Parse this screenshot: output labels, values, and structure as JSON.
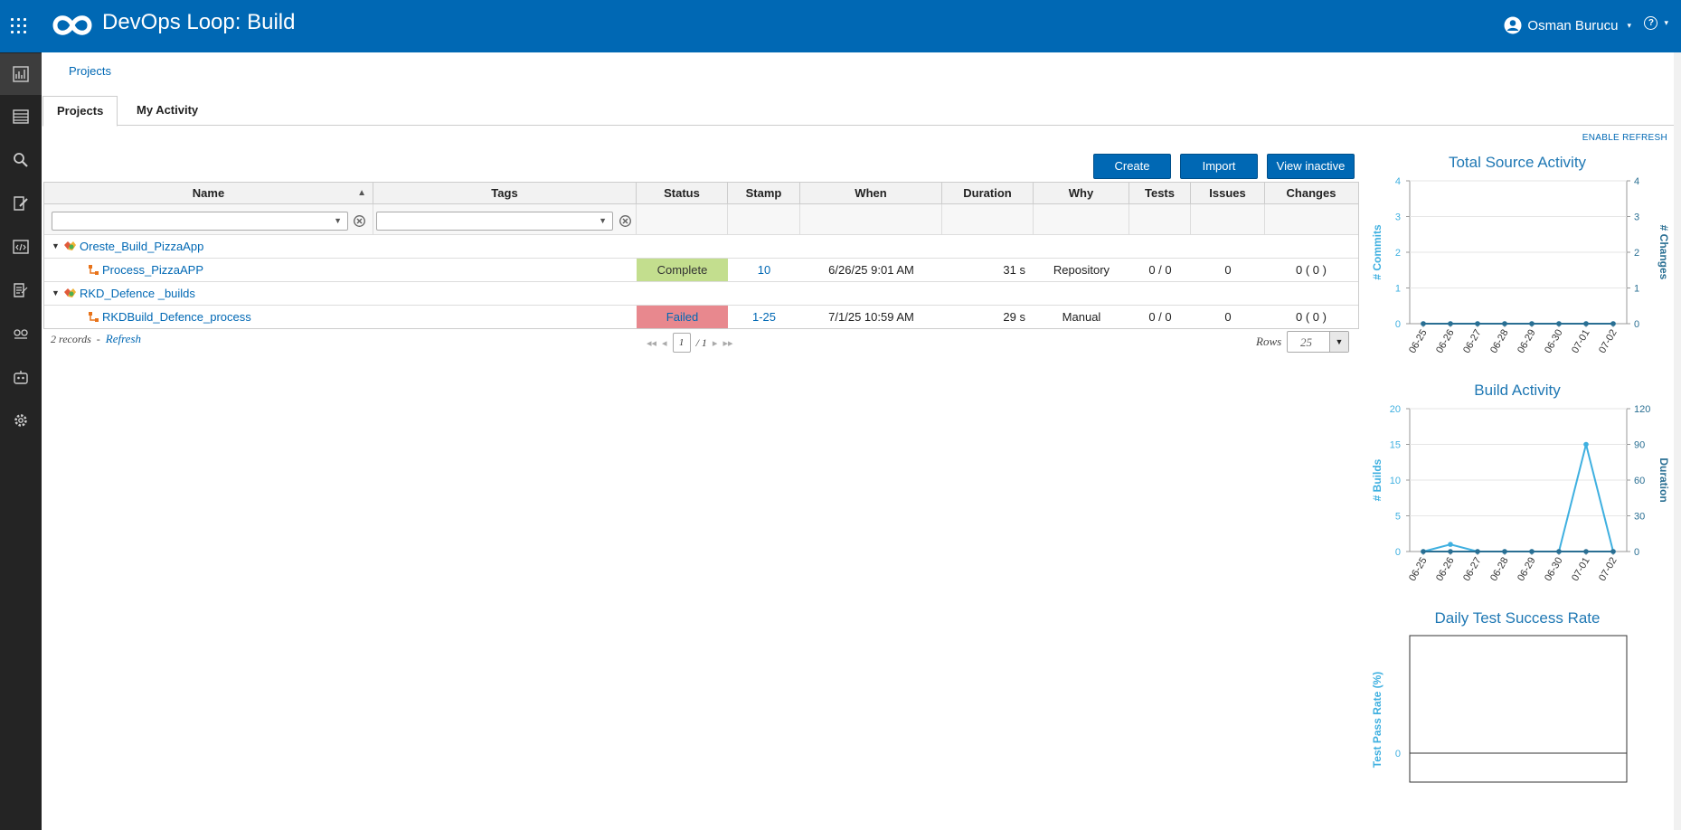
{
  "app": {
    "title": "DevOps Loop: Build"
  },
  "user": {
    "name": "Osman Burucu"
  },
  "breadcrumb": {
    "projects": "Projects"
  },
  "tabs": [
    {
      "label": "Projects",
      "active": true
    },
    {
      "label": "My Activity",
      "active": false
    }
  ],
  "toolbar": {
    "enable_refresh": "ENABLE REFRESH",
    "create": "Create",
    "import": "Import",
    "view_inactive": "View inactive"
  },
  "grid": {
    "columns": [
      "Name",
      "Tags",
      "Status",
      "Stamp",
      "When",
      "Duration",
      "Why",
      "Tests",
      "Issues",
      "Changes"
    ],
    "groups": [
      {
        "name": "Oreste_Build_PizzaApp",
        "process": {
          "name": "Process_PizzaAPP",
          "status": "Complete",
          "stamp": "10",
          "when": "6/26/25 9:01 AM",
          "duration": "31 s",
          "why": "Repository",
          "tests": "0 / 0",
          "issues": "0",
          "changes": "0 ( 0 )"
        }
      },
      {
        "name": "RKD_Defence _builds",
        "process": {
          "name": "RKDBuild_Defence_process",
          "status": "Failed",
          "stamp": "1-25",
          "when": "7/1/25 10:59 AM",
          "duration": "29 s",
          "why": "Manual",
          "tests": "0 / 0",
          "issues": "0",
          "changes": "0 ( 0 )"
        }
      }
    ]
  },
  "footer": {
    "records": "2 records",
    "sep": "-",
    "refresh": "Refresh",
    "page": "1",
    "of": "/ 1",
    "rows_label": "Rows",
    "rows_value": "25"
  },
  "colors": {
    "brand": "#0068b4",
    "complete": "#c3de8e",
    "failed": "#e8888e",
    "chart_light": "#3fb0e0",
    "chart_dark": "#2a6f93"
  },
  "chart_data": [
    {
      "type": "line",
      "title": "Total Source Activity",
      "categories": [
        "06-25",
        "06-26",
        "06-27",
        "06-28",
        "06-29",
        "06-30",
        "07-01",
        "07-02"
      ],
      "ylabel": "# Commits",
      "y2label": "# Changes",
      "ylim": [
        0,
        4
      ],
      "y2lim": [
        0,
        4
      ],
      "yticks": [
        0,
        1,
        2,
        3,
        4
      ],
      "y2ticks": [
        0,
        1,
        2,
        3,
        4
      ],
      "series": [
        {
          "values": [
            0,
            0,
            0,
            0,
            0,
            0,
            0,
            0
          ],
          "axis": "left",
          "color": "#3fb0e0"
        },
        {
          "values": [
            0,
            0,
            0,
            0,
            0,
            0,
            0,
            0
          ],
          "axis": "right",
          "color": "#2a6f93"
        }
      ]
    },
    {
      "type": "line",
      "title": "Build Activity",
      "categories": [
        "06-25",
        "06-26",
        "06-27",
        "06-28",
        "06-29",
        "06-30",
        "07-01",
        "07-02"
      ],
      "ylabel": "# Builds",
      "y2label": "Duration",
      "ylim": [
        0,
        20
      ],
      "y2lim": [
        0,
        120
      ],
      "yticks": [
        0,
        5,
        10,
        15,
        20
      ],
      "y2ticks": [
        0,
        30,
        60,
        90,
        120
      ],
      "series": [
        {
          "values": [
            0,
            1,
            0,
            0,
            0,
            0,
            15,
            0
          ],
          "axis": "left",
          "color": "#3fb0e0"
        },
        {
          "values": [
            0,
            0,
            0,
            0,
            0,
            0,
            0,
            0
          ],
          "axis": "right",
          "color": "#2a6f93"
        }
      ]
    },
    {
      "type": "line",
      "title": "Daily Test Success Rate",
      "ylabel": "Test Pass Rate (%)",
      "yticks": [
        0
      ],
      "series": []
    }
  ]
}
